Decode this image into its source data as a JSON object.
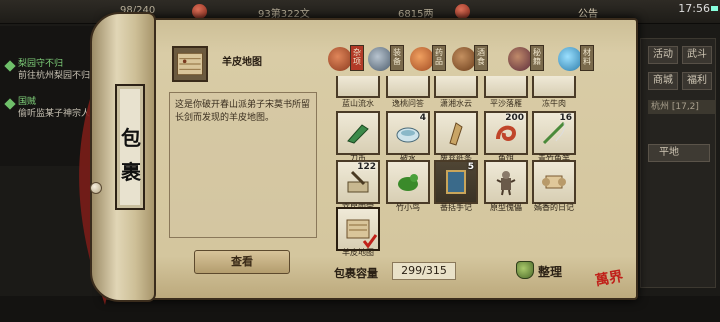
{
  "hud": {
    "hp": "98/240",
    "position": "93第322文",
    "money": "6815两",
    "announcement": "公告",
    "time": "17:56"
  },
  "quests": [
    {
      "title": "梨园守不归",
      "desc": "前往杭州梨园不归"
    },
    {
      "title": "国贼",
      "desc": "偷听监某子神宗人语"
    }
  ],
  "right_panel": {
    "buttons": [
      "活动",
      "武斗",
      "商城",
      "福利"
    ],
    "location": "杭州  [17,2]",
    "terrain": "平地"
  },
  "book": {
    "title_chars": [
      "包",
      "裹"
    ],
    "selected_item": {
      "name": "羊皮地图",
      "description": "这是你破开春山派弟子宋莫书所留长剑而发现的羊皮地图。"
    },
    "view_button": "查看",
    "capacity_label": "包裹容量",
    "capacity_value": "299/315",
    "sort_button": "整理",
    "seal": "萬界"
  },
  "tabs": [
    {
      "label": "杂项",
      "icon": "pot-icon",
      "active": true,
      "color": "#b7542e"
    },
    {
      "label": "装备",
      "icon": "sword-icon",
      "active": false,
      "color": "#6a7a8a"
    },
    {
      "label": "药品",
      "icon": "gourd-icon",
      "active": false,
      "color": "#c86a3b"
    },
    {
      "label": "酒食",
      "icon": "wine-icon",
      "active": false,
      "color": "#8a5a2c"
    },
    {
      "label": "秘籍",
      "icon": "book-icon",
      "active": false,
      "color": "#3a6ca0"
    },
    {
      "label": "材料",
      "icon": "crystal-icon",
      "active": false,
      "color": "#3aa0c8"
    }
  ],
  "top_row_labels": [
    "蓝山流水",
    "逸桃问答",
    "潇湘水云",
    "平沙落雁",
    "冻牛肉"
  ],
  "items": [
    {
      "name": "刀币",
      "count": "",
      "icon": "coin-knife-icon",
      "color": "#3c8a4a"
    },
    {
      "name": "破水",
      "count": "4",
      "icon": "bowl-icon",
      "color": "#8ab8c8"
    },
    {
      "name": "废弃纸条",
      "count": "",
      "icon": "paper-icon",
      "color": "#b08a4a"
    },
    {
      "name": "鱼饵",
      "count": "200",
      "icon": "worm-icon",
      "color": "#c0452a"
    },
    {
      "name": "青竹鱼竿",
      "count": "16",
      "icon": "rod-icon",
      "color": "#4a8a3a"
    },
    {
      "name": "文房四宝",
      "count": "122",
      "icon": "brush-icon",
      "color": "#8a7a5a"
    },
    {
      "name": "竹小鸟",
      "count": "",
      "icon": "bird-icon",
      "color": "#3a8a2a"
    },
    {
      "name": "番括手记",
      "count": "5",
      "icon": "notebook-icon",
      "color": "#3a6a8a"
    },
    {
      "name": "原型傀儡",
      "count": "",
      "icon": "puppet-icon",
      "color": "#6a5a4a"
    },
    {
      "name": "嫣香的日记",
      "count": "",
      "icon": "scroll-icon",
      "color": "#b89a6a"
    },
    {
      "name": "羊皮地图",
      "count": "",
      "icon": "map-icon",
      "color": "#9a7a52",
      "selected": true
    }
  ]
}
